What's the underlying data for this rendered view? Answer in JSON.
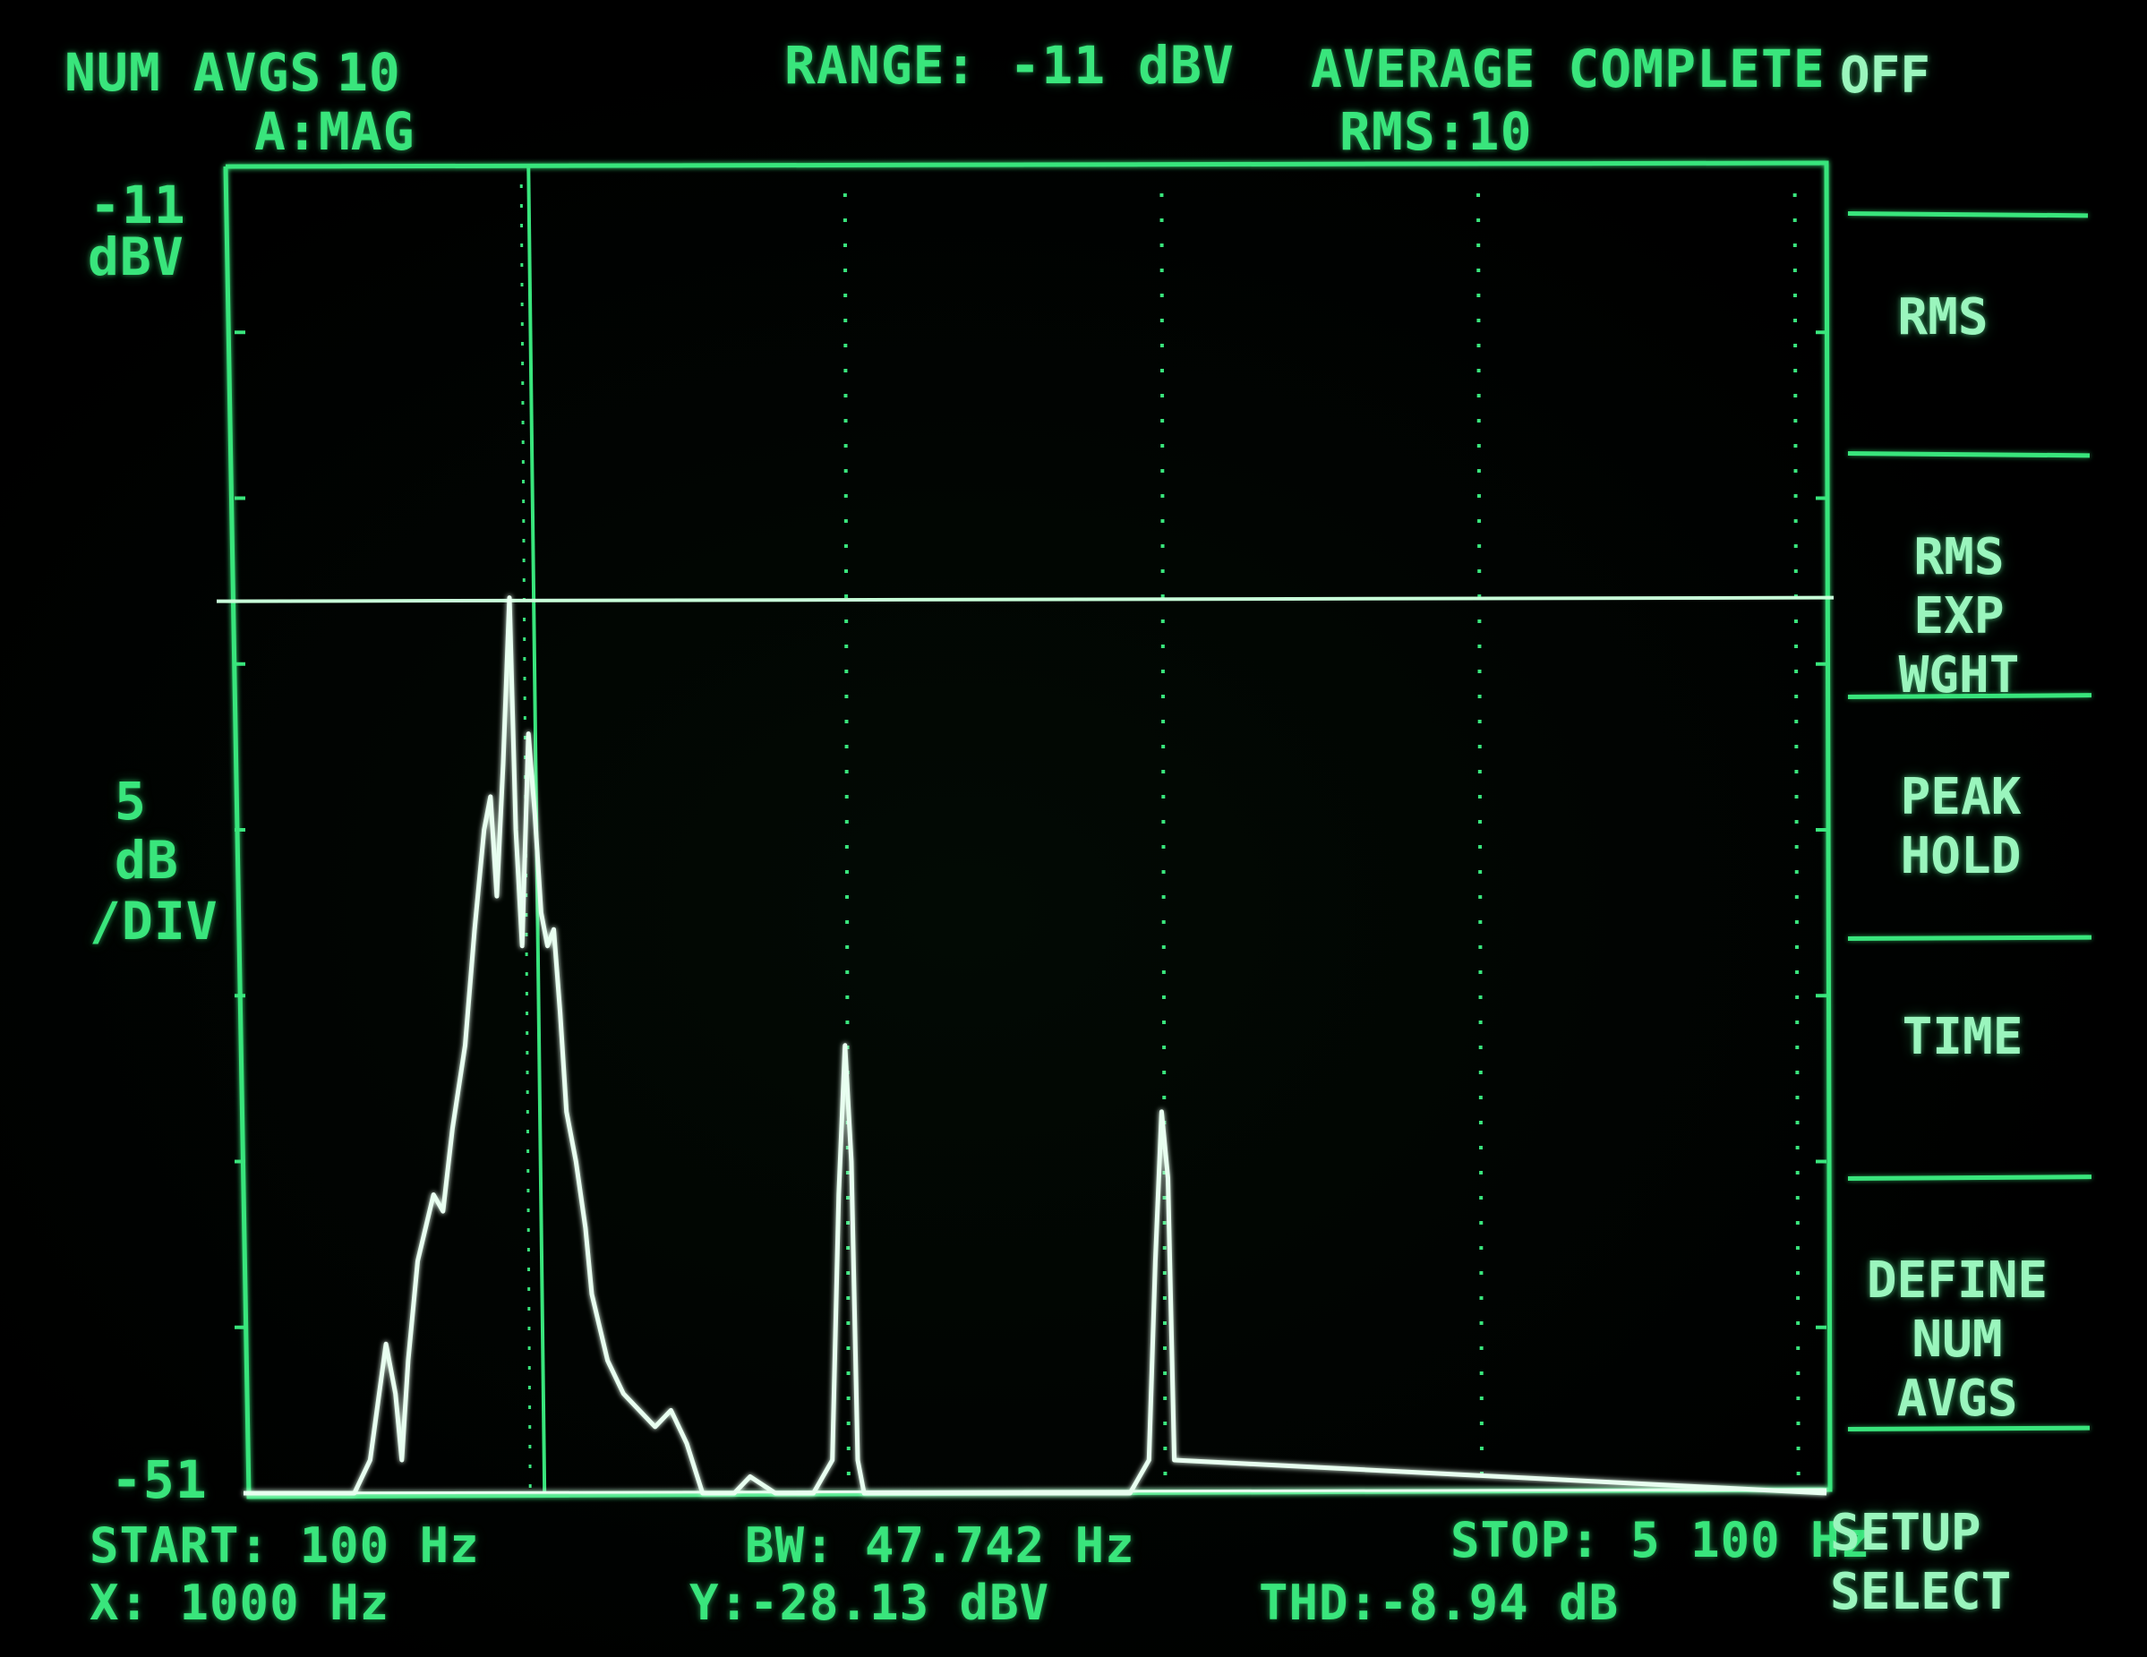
{
  "header": {
    "num_avgs_label": "NUM AVGS",
    "num_avgs_value": "10",
    "trace_label": "A:MAG",
    "range": "RANGE: -11 dBV",
    "status": "AVERAGE COMPLETE",
    "rms_count": "RMS:10",
    "softkey_top": "OFF"
  },
  "axis": {
    "top_value": "-11",
    "top_unit": "dBV",
    "scale_value": "5",
    "scale_unit": "dB",
    "scale_per": "/DIV",
    "bottom_value": "-51"
  },
  "footer": {
    "start": "START: 100 Hz",
    "marker_x": "X: 1000 Hz",
    "bw": "BW: 47.742 Hz",
    "marker_y": "Y:-28.13 dBV",
    "stop": "STOP: 5 100 Hz",
    "thd": "THD:-8.94 dB"
  },
  "softkeys": [
    {
      "label": "RMS"
    },
    {
      "label": "RMS\nEXP WGHT"
    },
    {
      "label": "PEAK\nHOLD"
    },
    {
      "label": "TIME"
    },
    {
      "label": "DEFINE\nNUM AVGS"
    },
    {
      "label": "SETUP\nSELECT"
    }
  ],
  "colors": {
    "phosphor": "#39e57c",
    "trace": "#e8fff0",
    "background": "#000000"
  },
  "chart_data": {
    "type": "line",
    "title": "",
    "xlabel": "",
    "ylabel": "",
    "xlim": [
      100,
      5100
    ],
    "ylim": [
      -51,
      -11
    ],
    "x_divisions": 10,
    "y_divisions": 8,
    "marker_x": 1000,
    "marker_y": -28.13,
    "harmonic_markers": [
      2000,
      3000,
      4000,
      5000
    ],
    "series": [
      {
        "x": [
          100,
          450,
          500,
          550,
          580,
          600,
          620,
          650,
          700,
          730,
          760,
          800,
          830,
          860,
          880,
          900,
          920,
          940,
          960,
          980,
          1000,
          1020,
          1040,
          1060,
          1080,
          1100,
          1120,
          1150,
          1180,
          1200,
          1250,
          1300,
          1350,
          1400,
          1450,
          1500,
          1550,
          1600,
          1650,
          1700,
          1780,
          1800,
          1900,
          1960,
          1980,
          2000,
          2020,
          2040,
          2060,
          2500,
          2900,
          2960,
          2980,
          3000,
          3020,
          3040,
          5100
        ],
        "y": [
          -51,
          -51,
          -50,
          -46.5,
          -48,
          -50,
          -47,
          -44,
          -42,
          -42.5,
          -40,
          -37.5,
          -34,
          -31,
          -30,
          -33,
          -29,
          -24,
          -31,
          -34.5,
          -28.1,
          -30.5,
          -33.5,
          -34.5,
          -34,
          -36.5,
          -39.5,
          -41,
          -43,
          -45,
          -47,
          -48,
          -48.5,
          -49,
          -48.5,
          -49.5,
          -51,
          -51,
          -51,
          -50.5,
          -51,
          -51,
          -51,
          -50,
          -42,
          -37.5,
          -41,
          -50,
          -51,
          -51,
          -51,
          -50,
          -44,
          -39.5,
          -41.5,
          -50,
          -51
        ]
      }
    ]
  }
}
